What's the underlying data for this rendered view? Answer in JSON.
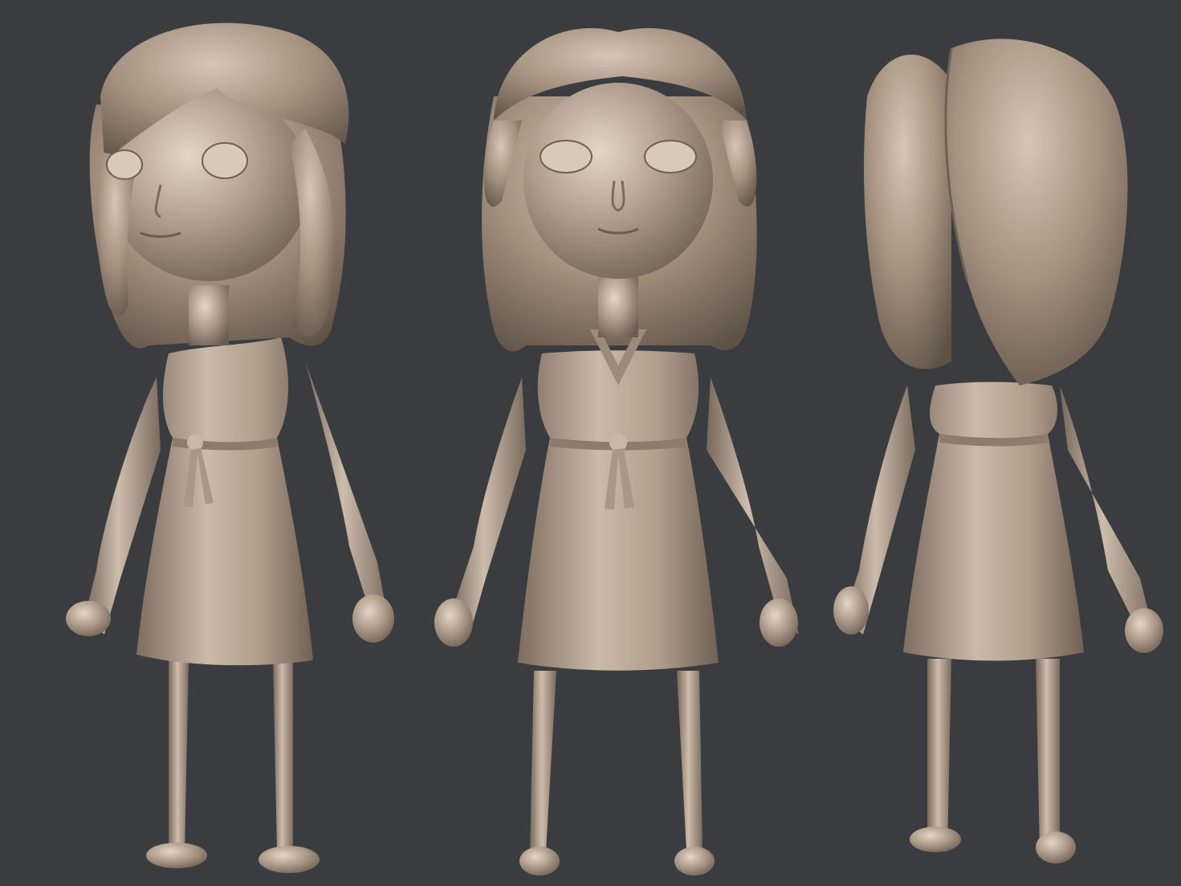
{
  "scene": {
    "background_color": "#3b3c40",
    "material_color": "#a8978a",
    "views": [
      {
        "id": "three-quarter",
        "label": ""
      },
      {
        "id": "front",
        "label": ""
      },
      {
        "id": "back",
        "label": ""
      }
    ]
  }
}
